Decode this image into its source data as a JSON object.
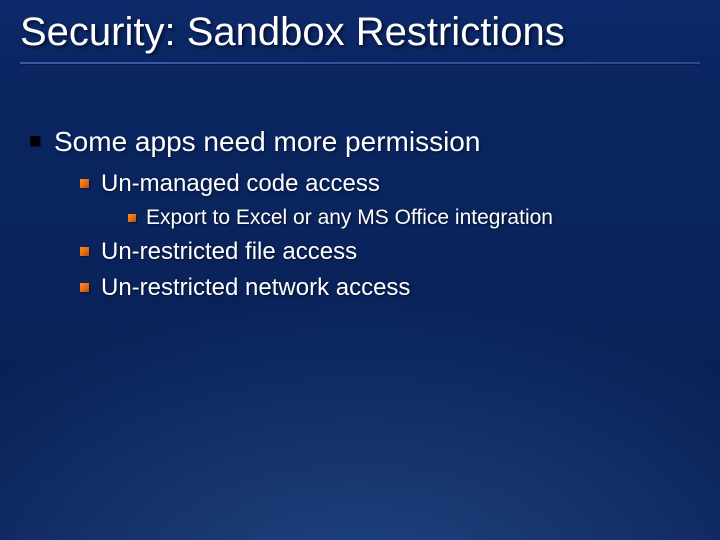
{
  "title": "Security: Sandbox Restrictions",
  "bullets": {
    "l1_0": "Some apps need more permission",
    "l2_0": "Un-managed code access",
    "l3_0": "Export to Excel or any MS Office integration",
    "l2_1": "Un-restricted file access",
    "l2_2": "Un-restricted network access"
  }
}
